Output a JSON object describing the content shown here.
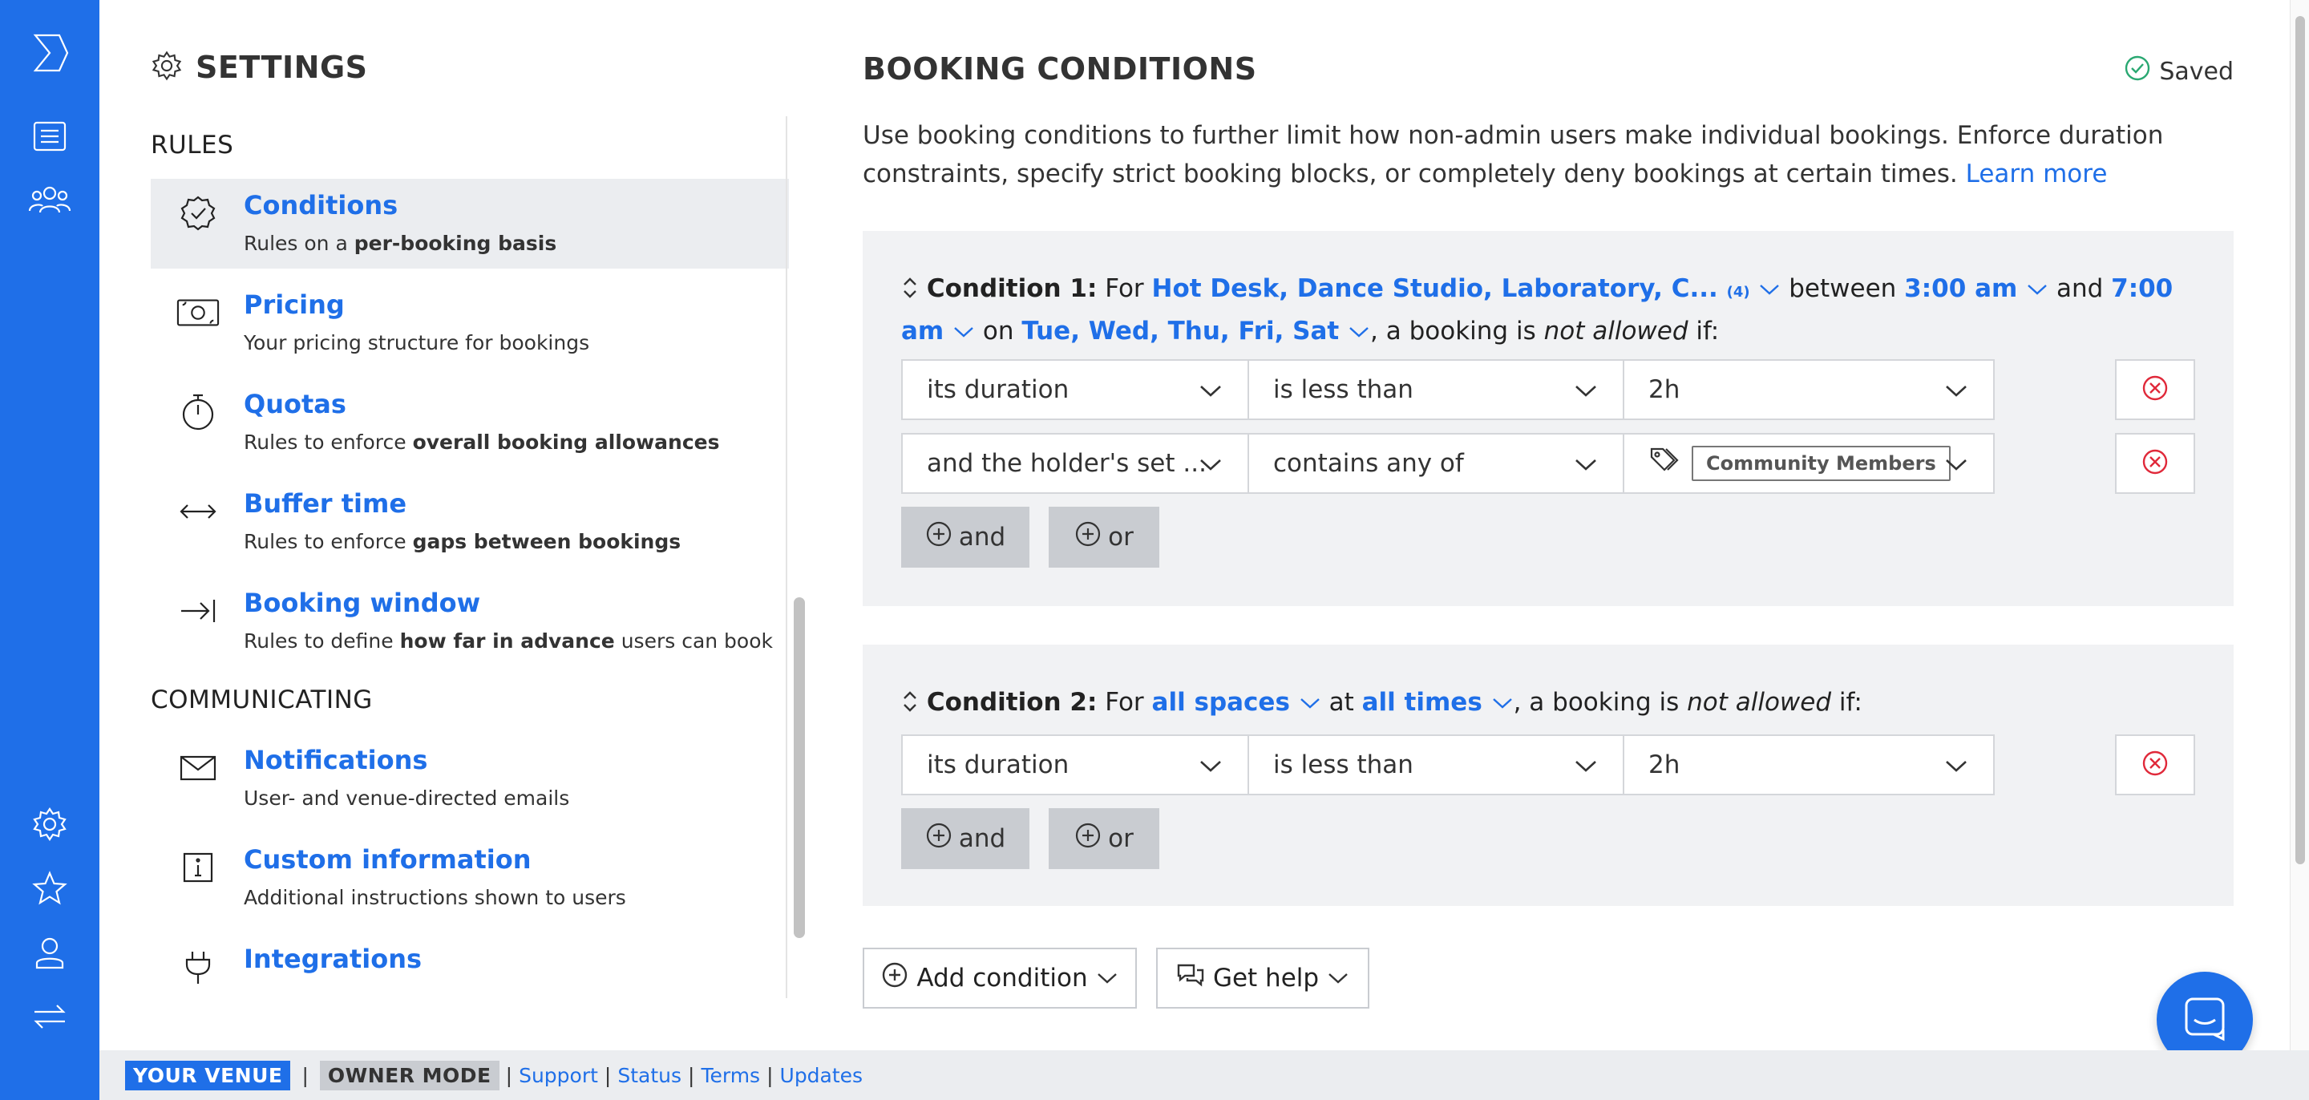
{
  "settings": {
    "title": "SETTINGS"
  },
  "sections": {
    "rules": "RULES",
    "communicating": "COMMUNICATING"
  },
  "rules_items": [
    {
      "title": "Conditions",
      "sub_pre": "Rules on a ",
      "sub_bold": "per-booking basis",
      "sub_post": "",
      "icon": "badge-check-icon"
    },
    {
      "title": "Pricing",
      "sub_pre": "Your pricing structure for bookings",
      "sub_bold": "",
      "sub_post": "",
      "icon": "money-icon"
    },
    {
      "title": "Quotas",
      "sub_pre": "Rules to enforce ",
      "sub_bold": "overall booking allowances",
      "sub_post": "",
      "icon": "stopwatch-icon"
    },
    {
      "title": "Buffer time",
      "sub_pre": "Rules to enforce ",
      "sub_bold": "gaps between bookings",
      "sub_post": "",
      "icon": "arrows-horizontal-icon"
    },
    {
      "title": "Booking window",
      "sub_pre": "Rules to define ",
      "sub_bold": "how far in advance",
      "sub_post": " users can book",
      "icon": "arrow-to-line-icon"
    }
  ],
  "communicating_items": [
    {
      "title": "Notifications",
      "sub": "User- and venue-directed emails",
      "icon": "envelope-icon"
    },
    {
      "title": "Custom information",
      "sub": "Additional instructions shown to users",
      "icon": "info-icon"
    },
    {
      "title": "Integrations",
      "sub": "",
      "icon": "plug-icon"
    }
  ],
  "main": {
    "title": "BOOKING CONDITIONS",
    "saved": "Saved",
    "description": "Use booking conditions to further limit how non-admin users make individual bookings. Enforce duration constraints, specify strict booking blocks, or completely deny bookings at certain times.",
    "learn_more": "Learn more"
  },
  "condition1": {
    "label": "Condition 1:",
    "for": "For",
    "spaces": "Hot Desk, Dance Studio, Laboratory, C...",
    "spaces_count": "(4)",
    "between": "between",
    "start": "3:00 am",
    "and": "and",
    "end": "7:00 am",
    "on": "on",
    "days": "Tue, Wed, Thu, Fri, Sat",
    "booking_is": ", a booking is",
    "not_allowed": "not allowed",
    "if": "if:",
    "rows": [
      {
        "field": "its duration",
        "op": "is less than",
        "value": "2h",
        "tag": ""
      },
      {
        "field": "and the holder's set ...",
        "op": "contains any of",
        "value": "",
        "tag": "Community Members"
      }
    ]
  },
  "condition2": {
    "label": "Condition 2:",
    "for": "For",
    "spaces": "all spaces",
    "at": "at",
    "times": "all times",
    "booking_is": ", a booking is",
    "not_allowed": "not allowed",
    "if": "if:",
    "rows": [
      {
        "field": "its duration",
        "op": "is less than",
        "value": "2h"
      }
    ]
  },
  "buttons": {
    "and": "and",
    "or": "or",
    "add_condition": "Add condition",
    "get_help": "Get help"
  },
  "footer": {
    "venue": "YOUR VENUE",
    "mode": "OWNER MODE",
    "links": [
      "Support",
      "Status",
      "Terms",
      "Updates"
    ]
  },
  "colors": {
    "brand": "#1f6fe8",
    "delete": "#e0293a",
    "saved": "#2aa872"
  }
}
